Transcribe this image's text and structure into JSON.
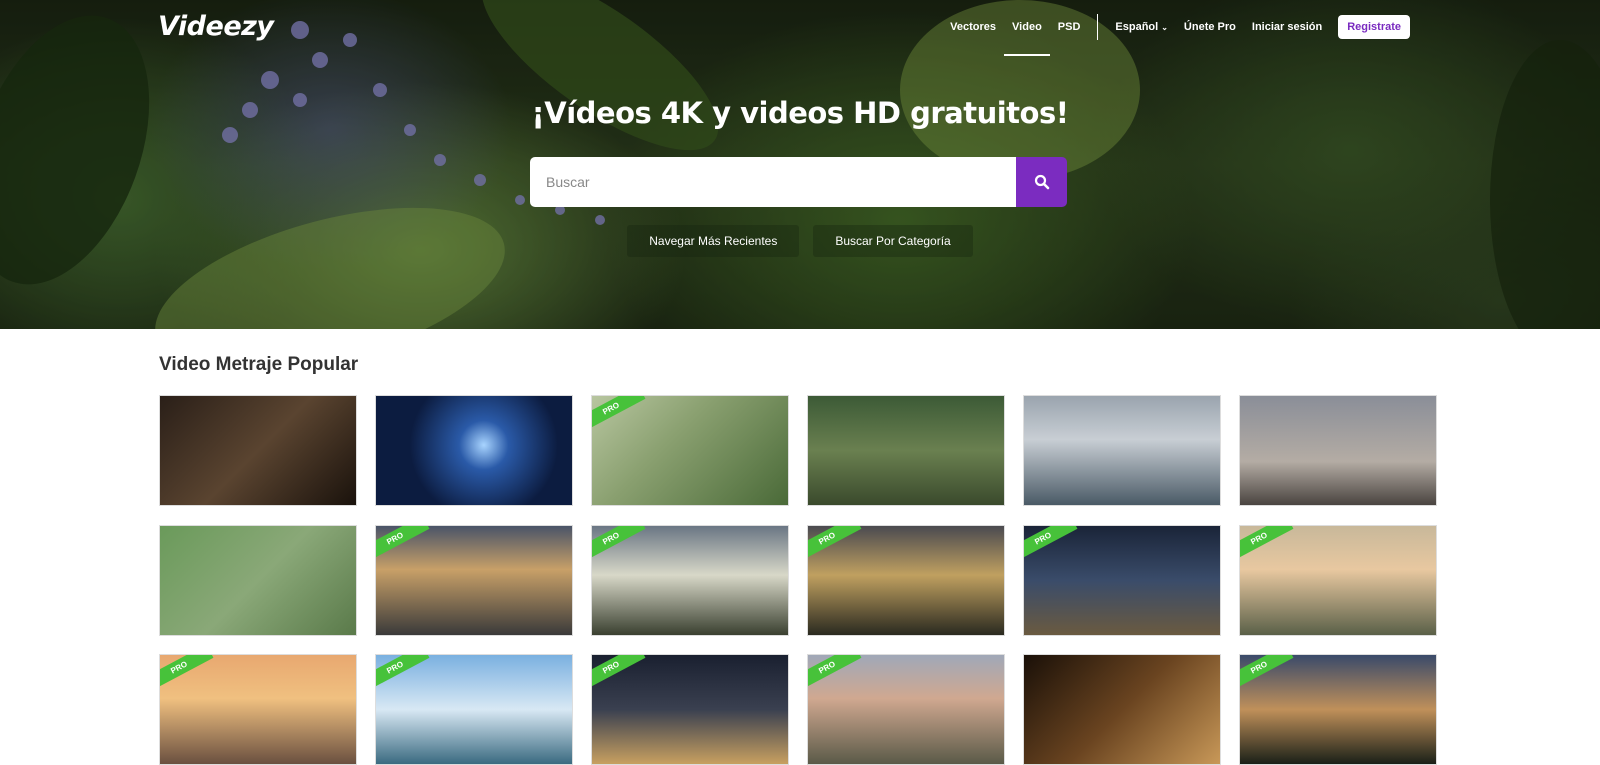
{
  "header": {
    "logo": "Videezy",
    "nav": [
      {
        "label": "Vectores",
        "active": false
      },
      {
        "label": "Video",
        "active": true
      },
      {
        "label": "PSD",
        "active": false
      }
    ],
    "language": "Español",
    "join_pro": "Únete Pro",
    "login": "Iniciar sesión",
    "register": "Registrate"
  },
  "hero": {
    "title": "¡Vídeos 4K y videos HD gratuitos!",
    "search_placeholder": "Buscar",
    "browse_recent": "Navegar Más Recientes",
    "browse_category": "Buscar Por Categoría"
  },
  "colors": {
    "accent": "#7b2cc0",
    "pro_badge": "#47c23a"
  },
  "section": {
    "title": "Video Metraje Popular",
    "pro_label": "PRO",
    "thumbnails": [
      {
        "pro": false,
        "bg": "linear-gradient(135deg,#2a1f18,#5a4430 50%,#1a120c)"
      },
      {
        "pro": false,
        "bg": "radial-gradient(circle at 55% 45%,#a8d4ff 0%,#2a5aa8 20%,#0c1c40 60%)"
      },
      {
        "pro": true,
        "bg": "linear-gradient(135deg,#b8c6a0,#8aa070 40%,#4a6a38)"
      },
      {
        "pro": false,
        "bg": "linear-gradient(180deg,#3c5a36,#6a8050 50%,#3a4a2c)"
      },
      {
        "pro": false,
        "bg": "linear-gradient(180deg,#9aa4ae,#c8ced4 40%,#4a5a66)"
      },
      {
        "pro": false,
        "bg": "linear-gradient(180deg,#8a8e98,#b4aca4 60%,#4a4440)"
      },
      {
        "pro": false,
        "bg": "linear-gradient(135deg,#6a9a5a,#8aa878 50%,#5a7a4a)"
      },
      {
        "pro": true,
        "bg": "linear-gradient(180deg,#4a5468,#c8a068 40%,#3a3a3a)"
      },
      {
        "pro": true,
        "bg": "linear-gradient(180deg,#6a7684,#d8d8c8 45%,#3a4030)"
      },
      {
        "pro": true,
        "bg": "linear-gradient(180deg,#4a4a50,#c0a060 45%,#2a2a20)"
      },
      {
        "pro": true,
        "bg": "linear-gradient(180deg,#1a2438,#3a4c6a 50%,#6a5a40)"
      },
      {
        "pro": true,
        "bg": "linear-gradient(180deg,#c8b89a,#e8c8a0 40%,#5a6048)"
      },
      {
        "pro": true,
        "bg": "linear-gradient(180deg,#e8a870,#f0c080 40%,#6a5040)"
      },
      {
        "pro": true,
        "bg": "linear-gradient(180deg,#7ab0e0,#d8e8f4 50%,#3a6a80)"
      },
      {
        "pro": true,
        "bg": "linear-gradient(180deg,#1a2030,#3a4050 50%,#c8a060)"
      },
      {
        "pro": true,
        "bg": "linear-gradient(180deg,#a0a8b8,#d0a890 40%,#5a5a48)"
      },
      {
        "pro": false,
        "bg": "linear-gradient(135deg,#1a1008,#6a4420 50%,#c89858)"
      },
      {
        "pro": true,
        "bg": "linear-gradient(180deg,#3a4a6a,#c0905a 50%,#1a2018)"
      }
    ]
  }
}
